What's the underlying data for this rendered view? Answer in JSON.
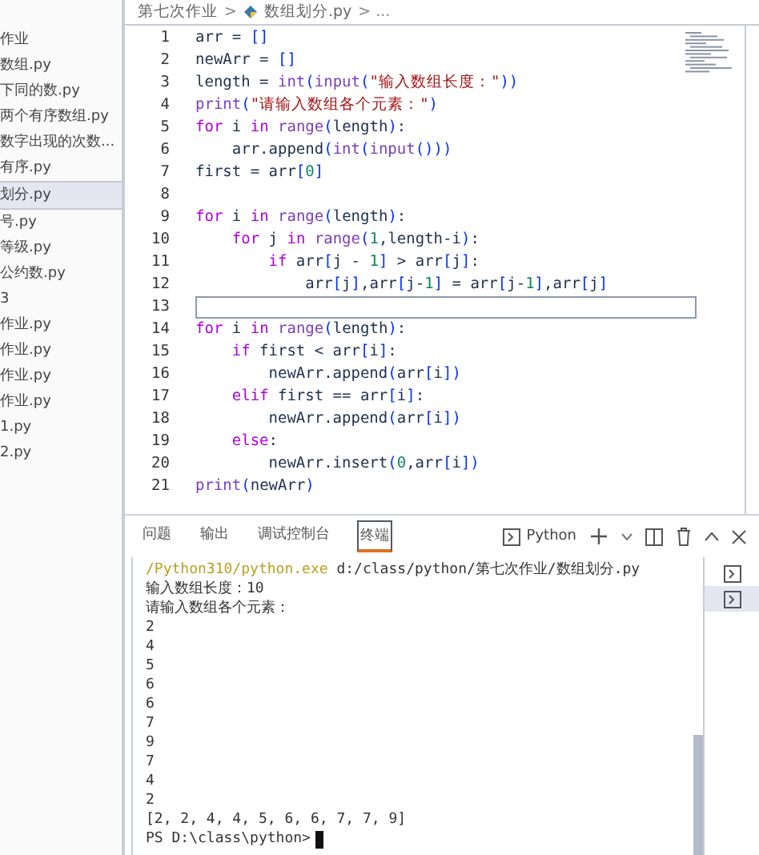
{
  "sidebar": {
    "items": [
      {
        "label": "作业",
        "selected": false
      },
      {
        "label": "数组.py",
        "selected": false
      },
      {
        "label": "下同的数.py",
        "selected": false
      },
      {
        "label": "两个有序数组.py",
        "selected": false
      },
      {
        "label": "数字出现的次数...",
        "selected": false
      },
      {
        "label": "有序.py",
        "selected": false
      },
      {
        "label": "划分.py",
        "selected": true
      },
      {
        "label": "号.py",
        "selected": false
      },
      {
        "label": "等级.py",
        "selected": false
      },
      {
        "label": "公约数.py",
        "selected": false
      },
      {
        "label": "3",
        "selected": false
      },
      {
        "label": "作业.py",
        "selected": false
      },
      {
        "label": "作业.py",
        "selected": false
      },
      {
        "label": "作业.py",
        "selected": false
      },
      {
        "label": "作业.py",
        "selected": false
      },
      {
        "label": "1.py",
        "selected": false
      },
      {
        "label": "2.py",
        "selected": false
      }
    ]
  },
  "breadcrumb": {
    "folder": "第七次作业",
    "separator": ">",
    "file": "数组划分.py",
    "more": "> ..."
  },
  "editor": {
    "lines": [
      {
        "number": "1",
        "current": false,
        "tokens": [
          {
            "kind": "plain",
            "text": "arr = "
          },
          {
            "kind": "br",
            "text": "[]"
          }
        ]
      },
      {
        "number": "2",
        "current": false,
        "tokens": [
          {
            "kind": "plain",
            "text": "newArr = "
          },
          {
            "kind": "br",
            "text": "[]"
          }
        ]
      },
      {
        "number": "3",
        "current": false,
        "tokens": [
          {
            "kind": "plain",
            "text": "length = "
          },
          {
            "kind": "fn",
            "text": "int"
          },
          {
            "kind": "br",
            "text": "("
          },
          {
            "kind": "fn",
            "text": "input"
          },
          {
            "kind": "br",
            "text": "("
          },
          {
            "kind": "str",
            "text": "\"输入数组长度：\""
          },
          {
            "kind": "br",
            "text": "))"
          }
        ]
      },
      {
        "number": "4",
        "current": false,
        "tokens": [
          {
            "kind": "fn",
            "text": "print"
          },
          {
            "kind": "br",
            "text": "("
          },
          {
            "kind": "str",
            "text": "\"请输入数组各个元素：\""
          },
          {
            "kind": "br",
            "text": ")"
          }
        ]
      },
      {
        "number": "5",
        "current": false,
        "tokens": [
          {
            "kind": "kw",
            "text": "for"
          },
          {
            "kind": "plain",
            "text": " i "
          },
          {
            "kind": "kw",
            "text": "in "
          },
          {
            "kind": "fn",
            "text": "range"
          },
          {
            "kind": "br",
            "text": "("
          },
          {
            "kind": "plain",
            "text": "length"
          },
          {
            "kind": "br",
            "text": ")"
          },
          {
            "kind": "plain",
            "text": ":"
          }
        ]
      },
      {
        "number": "6",
        "current": false,
        "tokens": [
          {
            "kind": "plain",
            "text": "    arr.append"
          },
          {
            "kind": "br",
            "text": "("
          },
          {
            "kind": "fn",
            "text": "int"
          },
          {
            "kind": "br",
            "text": "("
          },
          {
            "kind": "fn",
            "text": "input"
          },
          {
            "kind": "br",
            "text": "()))"
          }
        ]
      },
      {
        "number": "7",
        "current": false,
        "tokens": [
          {
            "kind": "plain",
            "text": "first = arr"
          },
          {
            "kind": "br",
            "text": "["
          },
          {
            "kind": "num",
            "text": "0"
          },
          {
            "kind": "br",
            "text": "]"
          }
        ]
      },
      {
        "number": "8",
        "current": false
      },
      {
        "number": "9",
        "current": false,
        "tokens": [
          {
            "kind": "kw",
            "text": "for"
          },
          {
            "kind": "plain",
            "text": " i "
          },
          {
            "kind": "kw",
            "text": "in "
          },
          {
            "kind": "fn",
            "text": "range"
          },
          {
            "kind": "br",
            "text": "("
          },
          {
            "kind": "plain",
            "text": "length"
          },
          {
            "kind": "br",
            "text": ")"
          },
          {
            "kind": "plain",
            "text": ":"
          }
        ]
      },
      {
        "number": "10",
        "current": false,
        "tokens": [
          {
            "kind": "kw",
            "text": "    for"
          },
          {
            "kind": "plain",
            "text": " j "
          },
          {
            "kind": "kw",
            "text": "in "
          },
          {
            "kind": "fn",
            "text": "range"
          },
          {
            "kind": "br",
            "text": "("
          },
          {
            "kind": "num",
            "text": "1"
          },
          {
            "kind": "plain",
            "text": ",length-i"
          },
          {
            "kind": "br",
            "text": ")"
          },
          {
            "kind": "plain",
            "text": ":"
          }
        ]
      },
      {
        "number": "11",
        "current": false,
        "tokens": [
          {
            "kind": "kw",
            "text": "        if"
          },
          {
            "kind": "plain",
            "text": " arr"
          },
          {
            "kind": "br",
            "text": "["
          },
          {
            "kind": "plain",
            "text": "j - "
          },
          {
            "kind": "num",
            "text": "1"
          },
          {
            "kind": "br",
            "text": "]"
          },
          {
            "kind": "plain",
            "text": " > arr"
          },
          {
            "kind": "br",
            "text": "["
          },
          {
            "kind": "plain",
            "text": "j"
          },
          {
            "kind": "br",
            "text": "]"
          },
          {
            "kind": "plain",
            "text": ":"
          }
        ]
      },
      {
        "number": "12",
        "current": false,
        "tokens": [
          {
            "kind": "plain",
            "text": "            arr"
          },
          {
            "kind": "br",
            "text": "["
          },
          {
            "kind": "plain",
            "text": "j"
          },
          {
            "kind": "br",
            "text": "]"
          },
          {
            "kind": "plain",
            "text": ",arr"
          },
          {
            "kind": "br",
            "text": "["
          },
          {
            "kind": "plain",
            "text": "j-"
          },
          {
            "kind": "num",
            "text": "1"
          },
          {
            "kind": "br",
            "text": "]"
          },
          {
            "kind": "plain",
            "text": " = arr"
          },
          {
            "kind": "br",
            "text": "["
          },
          {
            "kind": "plain",
            "text": "j-"
          },
          {
            "kind": "num",
            "text": "1"
          },
          {
            "kind": "br",
            "text": "]"
          },
          {
            "kind": "plain",
            "text": ",arr"
          },
          {
            "kind": "br",
            "text": "["
          },
          {
            "kind": "plain",
            "text": "j"
          },
          {
            "kind": "br",
            "text": "]"
          }
        ]
      },
      {
        "number": "13",
        "current": true
      },
      {
        "number": "14",
        "current": false,
        "tokens": [
          {
            "kind": "kw",
            "text": "for"
          },
          {
            "kind": "plain",
            "text": " i "
          },
          {
            "kind": "kw",
            "text": "in "
          },
          {
            "kind": "fn",
            "text": "range"
          },
          {
            "kind": "br",
            "text": "("
          },
          {
            "kind": "plain",
            "text": "length"
          },
          {
            "kind": "br",
            "text": ")"
          },
          {
            "kind": "plain",
            "text": ":"
          }
        ]
      },
      {
        "number": "15",
        "current": false,
        "tokens": [
          {
            "kind": "kw",
            "text": "    if"
          },
          {
            "kind": "plain",
            "text": " first < arr"
          },
          {
            "kind": "br",
            "text": "["
          },
          {
            "kind": "plain",
            "text": "i"
          },
          {
            "kind": "br",
            "text": "]"
          },
          {
            "kind": "plain",
            "text": ":"
          }
        ]
      },
      {
        "number": "16",
        "current": false,
        "tokens": [
          {
            "kind": "plain",
            "text": "        newArr.append"
          },
          {
            "kind": "br",
            "text": "("
          },
          {
            "kind": "plain",
            "text": "arr"
          },
          {
            "kind": "br",
            "text": "["
          },
          {
            "kind": "plain",
            "text": "i"
          },
          {
            "kind": "br",
            "text": "])"
          }
        ]
      },
      {
        "number": "17",
        "current": false,
        "tokens": [
          {
            "kind": "kw",
            "text": "    elif"
          },
          {
            "kind": "plain",
            "text": " first == arr"
          },
          {
            "kind": "br",
            "text": "["
          },
          {
            "kind": "plain",
            "text": "i"
          },
          {
            "kind": "br",
            "text": "]"
          },
          {
            "kind": "plain",
            "text": ":"
          }
        ]
      },
      {
        "number": "18",
        "current": false,
        "tokens": [
          {
            "kind": "plain",
            "text": "        newArr.append"
          },
          {
            "kind": "br",
            "text": "("
          },
          {
            "kind": "plain",
            "text": "arr"
          },
          {
            "kind": "br",
            "text": "["
          },
          {
            "kind": "plain",
            "text": "i"
          },
          {
            "kind": "br",
            "text": "])"
          }
        ]
      },
      {
        "number": "19",
        "current": false,
        "tokens": [
          {
            "kind": "kw",
            "text": "    else"
          },
          {
            "kind": "plain",
            "text": ":"
          }
        ]
      },
      {
        "number": "20",
        "current": false,
        "tokens": [
          {
            "kind": "plain",
            "text": "        newArr.insert"
          },
          {
            "kind": "br",
            "text": "("
          },
          {
            "kind": "num",
            "text": "0"
          },
          {
            "kind": "plain",
            "text": ",arr"
          },
          {
            "kind": "br",
            "text": "["
          },
          {
            "kind": "plain",
            "text": "i"
          },
          {
            "kind": "br",
            "text": "])"
          }
        ]
      },
      {
        "number": "21",
        "current": false,
        "tokens": [
          {
            "kind": "fn",
            "text": "print"
          },
          {
            "kind": "br",
            "text": "("
          },
          {
            "kind": "plain",
            "text": "newArr"
          },
          {
            "kind": "br",
            "text": ")"
          }
        ]
      }
    ]
  },
  "panel": {
    "tabs": [
      {
        "label": "问题",
        "selected": false
      },
      {
        "label": "输出",
        "selected": false
      },
      {
        "label": "调试控制台",
        "selected": false
      },
      {
        "label": "终端",
        "selected": true
      }
    ],
    "terminal_name": "Python",
    "terminal": {
      "command": {
        "program": "/Python310/python.exe",
        "args": " d:/class/python/第七次作业/数组划分.py"
      },
      "output": [
        "输入数组长度：10",
        "请输入数组各个元素：",
        "2",
        "4",
        "5",
        "6",
        "6",
        "7",
        "9",
        "7",
        "4",
        "2",
        "[2, 2, 4, 4, 5, 6, 6, 7, 7, 9]"
      ],
      "prompt": "PS D:\\class\\python>"
    },
    "terminal_list": [
      {
        "selected": false
      },
      {
        "selected": true
      }
    ]
  }
}
